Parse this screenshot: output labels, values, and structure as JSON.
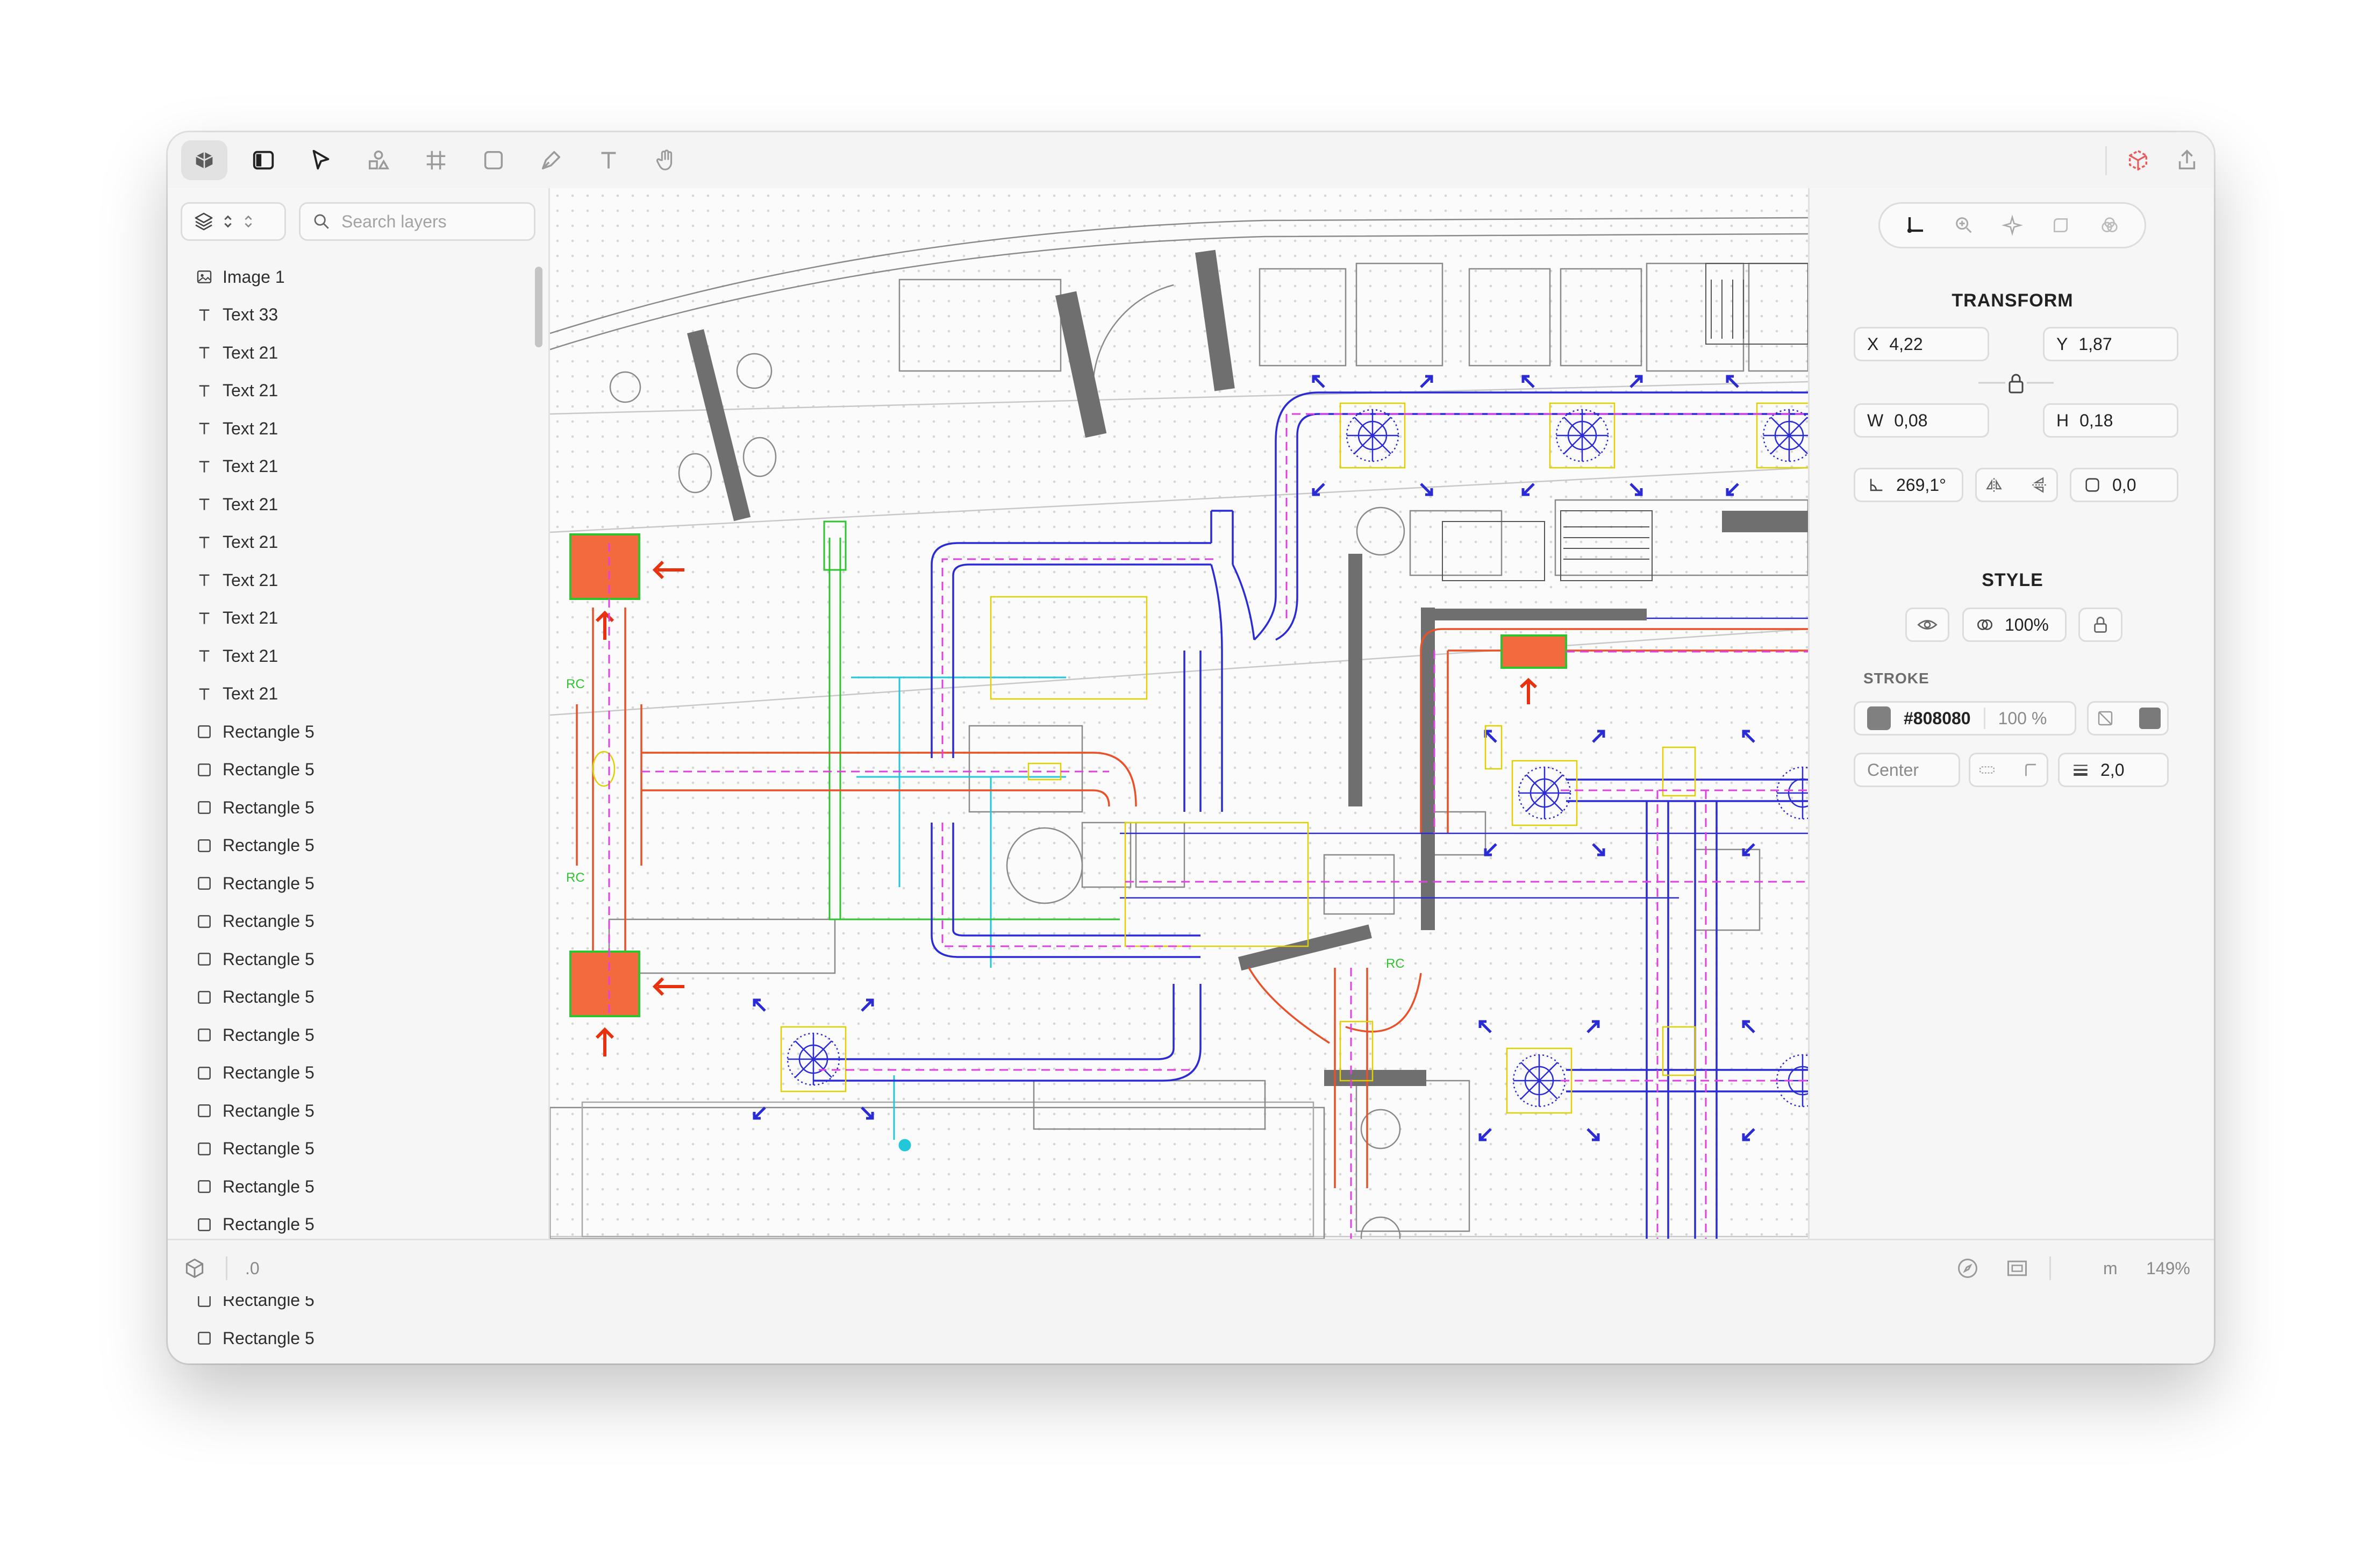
{
  "toolbar": {
    "tools": [
      "logo-icon",
      "sidebar-icon",
      "select-arrow-icon",
      "shapes-icon",
      "frame-icon",
      "rectangle-icon",
      "pen-icon",
      "text-icon",
      "hand-icon"
    ],
    "right_tools": [
      "cube-icon",
      "share-icon"
    ]
  },
  "left_panel": {
    "search_placeholder": "Search layers",
    "layers": [
      {
        "icon": "image",
        "name": "Image 1"
      },
      {
        "icon": "text",
        "name": "Text 33"
      },
      {
        "icon": "text",
        "name": "Text 21"
      },
      {
        "icon": "text",
        "name": "Text 21"
      },
      {
        "icon": "text",
        "name": "Text 21"
      },
      {
        "icon": "text",
        "name": "Text 21"
      },
      {
        "icon": "text",
        "name": "Text 21"
      },
      {
        "icon": "text",
        "name": "Text 21"
      },
      {
        "icon": "text",
        "name": "Text 21"
      },
      {
        "icon": "text",
        "name": "Text 21"
      },
      {
        "icon": "text",
        "name": "Text 21"
      },
      {
        "icon": "text",
        "name": "Text 21"
      },
      {
        "icon": "rect",
        "name": "Rectangle 5"
      },
      {
        "icon": "rect",
        "name": "Rectangle 5"
      },
      {
        "icon": "rect",
        "name": "Rectangle 5"
      },
      {
        "icon": "rect",
        "name": "Rectangle 5"
      },
      {
        "icon": "rect",
        "name": "Rectangle 5"
      },
      {
        "icon": "rect",
        "name": "Rectangle 5"
      },
      {
        "icon": "rect",
        "name": "Rectangle 5"
      },
      {
        "icon": "rect",
        "name": "Rectangle 5"
      },
      {
        "icon": "rect",
        "name": "Rectangle 5"
      },
      {
        "icon": "rect",
        "name": "Rectangle 5"
      },
      {
        "icon": "rect",
        "name": "Rectangle 5"
      },
      {
        "icon": "rect",
        "name": "Rectangle 5"
      },
      {
        "icon": "rect",
        "name": "Rectangle 5"
      },
      {
        "icon": "rect",
        "name": "Rectangle 5"
      },
      {
        "icon": "rect",
        "name": "Rectangle 5"
      },
      {
        "icon": "rect",
        "name": "Rectangle 5"
      },
      {
        "icon": "rect",
        "name": "Rectangle 5"
      },
      {
        "icon": "rect",
        "name": "Rectangle 5"
      }
    ]
  },
  "canvas": {
    "labels": [
      "RC",
      "RC",
      "RC"
    ],
    "colors": {
      "duct_blue": "#2b2bd6",
      "duct_red": "#e8512a",
      "dash_magenta": "#e040e0",
      "yellow": "#e0d000",
      "green": "#2fc42f",
      "cyan": "#22c8d8",
      "wall_gray": "#6a6a6a"
    }
  },
  "right_panel": {
    "transform_title": "TRANSFORM",
    "x_label": "X",
    "x_value": "4,22",
    "y_label": "Y",
    "y_value": "1,87",
    "w_label": "W",
    "w_value": "0,08",
    "h_label": "H",
    "h_value": "0,18",
    "rotation_value": "269,1°",
    "radius_value": "0,0",
    "style_title": "STYLE",
    "opacity_value": "100%",
    "stroke_title": "STROKE",
    "stroke_color": "#808080",
    "stroke_opacity": "100 %",
    "stroke_align": "Center",
    "stroke_width": "2,0"
  },
  "statusbar": {
    "left_value": ".0",
    "unit": "m",
    "zoom": "149%"
  }
}
